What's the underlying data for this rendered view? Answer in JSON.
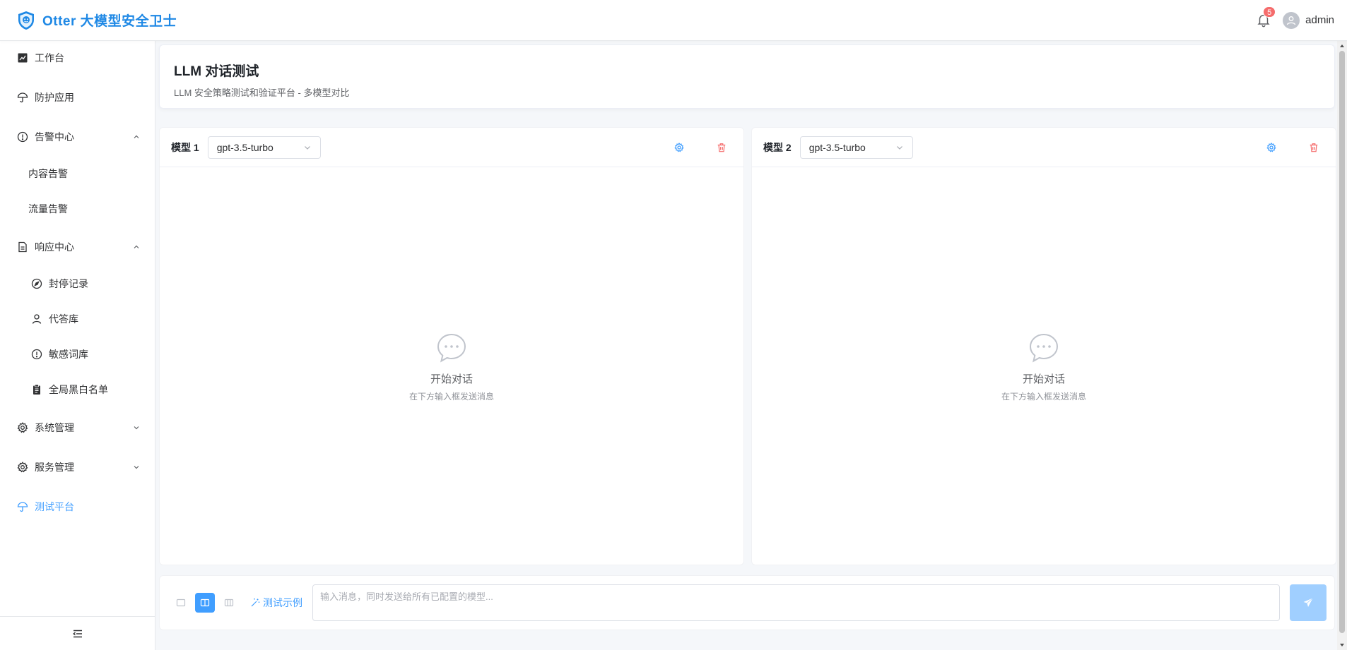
{
  "header": {
    "app_title": "Otter 大模型安全卫士",
    "notification_count": "5",
    "username": "admin"
  },
  "sidebar": {
    "items": [
      {
        "label": "工作台",
        "icon": "chart-line-icon"
      },
      {
        "label": "防护应用",
        "icon": "umbrella-icon"
      },
      {
        "label": "告警中心",
        "icon": "warning-circle-icon",
        "expanded": true,
        "children": [
          {
            "label": "内容告警"
          },
          {
            "label": "流量告警"
          }
        ]
      },
      {
        "label": "响应中心",
        "icon": "document-icon",
        "expanded": true,
        "children": [
          {
            "label": "封停记录",
            "icon": "compass-icon"
          },
          {
            "label": "代答库",
            "icon": "user-icon"
          },
          {
            "label": "敏感词库",
            "icon": "warning-circle-icon"
          },
          {
            "label": "全局黑白名单",
            "icon": "clipboard-icon"
          }
        ]
      },
      {
        "label": "系统管理",
        "icon": "gear-icon",
        "expanded": false
      },
      {
        "label": "服务管理",
        "icon": "gear-icon",
        "expanded": false
      },
      {
        "label": "测试平台",
        "icon": "umbrella-icon",
        "active": true
      }
    ]
  },
  "page": {
    "title": "LLM 对话测试",
    "subtitle": "LLM 安全策略测试和验证平台 - 多模型对比"
  },
  "panels": [
    {
      "label": "模型 1",
      "model": "gpt-3.5-turbo",
      "empty_title": "开始对话",
      "empty_desc": "在下方输入框发送消息"
    },
    {
      "label": "模型 2",
      "model": "gpt-3.5-turbo",
      "empty_title": "开始对话",
      "empty_desc": "在下方输入框发送消息"
    }
  ],
  "input_bar": {
    "examples_label": "测试示例",
    "placeholder": "输入消息，同时发送给所有已配置的模型...",
    "value": "",
    "active_layout": "two-column"
  },
  "colors": {
    "accent": "#409eff",
    "brand": "#1e88e5",
    "danger": "#f56c6c",
    "send_disabled": "#a0cfff"
  }
}
